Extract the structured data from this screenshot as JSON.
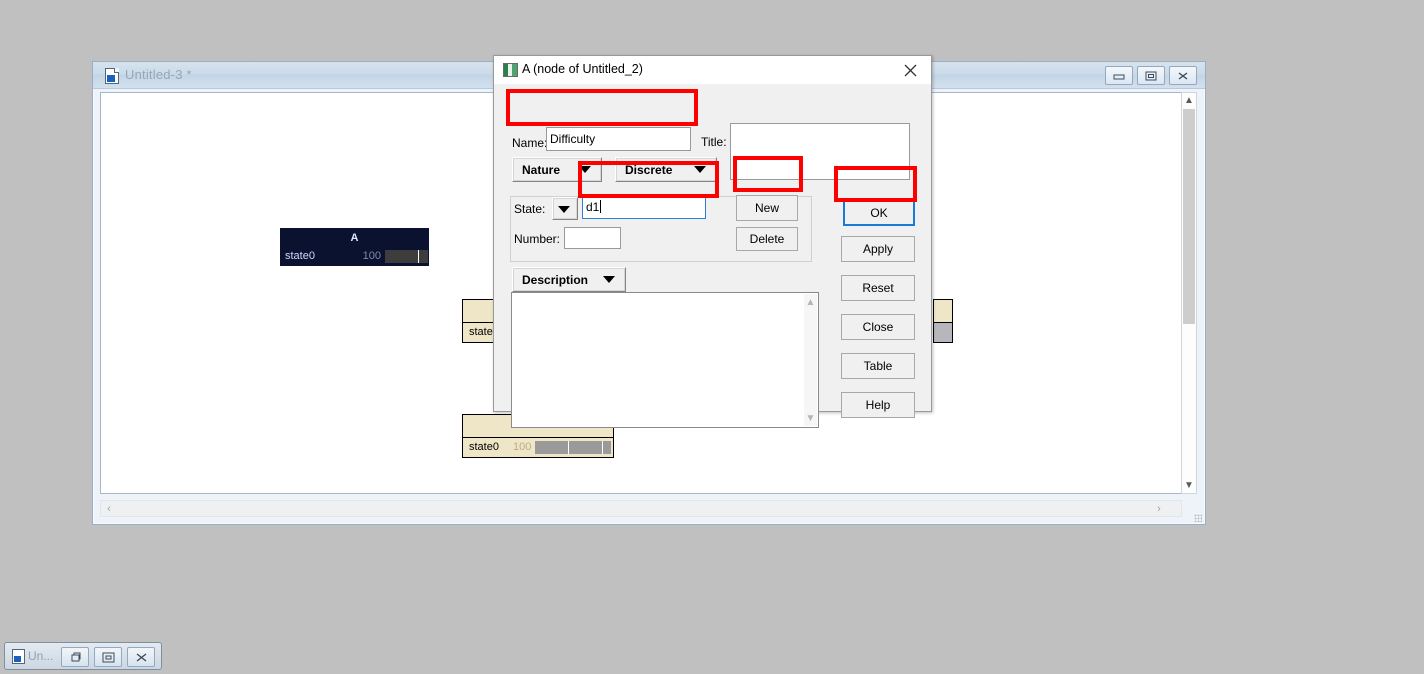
{
  "desktop": {
    "background_color": "#c0c0c0"
  },
  "mdi_window": {
    "title": "Untitled-3 *",
    "icon": "document-icon",
    "controls": {
      "minimize": "minimize-icon",
      "restore": "restore-icon",
      "close": "close-icon"
    }
  },
  "canvas": {
    "nodes": [
      {
        "id": "node-a",
        "header": "A",
        "state_label": "state0",
        "value": "100",
        "style": "dark"
      },
      {
        "id": "node-b",
        "state_label": "state",
        "value": "",
        "style": "beige"
      },
      {
        "id": "node-c",
        "state_label": "state0",
        "value": "100",
        "style": "beige"
      },
      {
        "id": "node-d",
        "state_label": "",
        "value": "",
        "style": "beige"
      }
    ]
  },
  "dialog": {
    "title": "A (node of Untitled_2)",
    "icon": "node-icon",
    "close_icon": "close-icon",
    "name_label": "Name:",
    "name_value": "Difficulty",
    "title_label": "Title:",
    "title_value": "",
    "nature_button": "Nature",
    "discrete_button": "Discrete",
    "state_label": "State:",
    "state_value": "d1",
    "number_label": "Number:",
    "number_value": "",
    "new_button": "New",
    "delete_button": "Delete",
    "description_button": "Description",
    "description_value": "",
    "buttons": {
      "ok": "OK",
      "apply": "Apply",
      "reset": "Reset",
      "close": "Close",
      "table": "Table",
      "help": "Help"
    }
  },
  "annotations": {
    "color": "#ff0000",
    "highlighted": [
      "name-field",
      "state-field",
      "new-button",
      "ok-button"
    ]
  },
  "taskbar": {
    "item_title": "Un...",
    "icon": "document-icon",
    "controls": {
      "restore": "restore-icon",
      "maximize": "maximize-icon",
      "close": "close-icon"
    }
  }
}
